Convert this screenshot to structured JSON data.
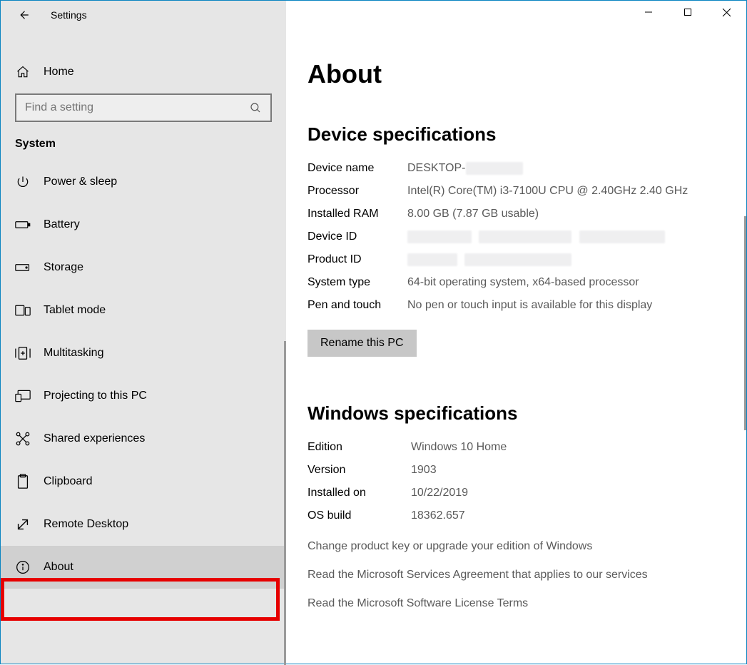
{
  "window": {
    "title": "Settings"
  },
  "sidebar": {
    "home_label": "Home",
    "search_placeholder": "Find a setting",
    "section_label": "System",
    "items": [
      {
        "label": "Power & sleep"
      },
      {
        "label": "Battery"
      },
      {
        "label": "Storage"
      },
      {
        "label": "Tablet mode"
      },
      {
        "label": "Multitasking"
      },
      {
        "label": "Projecting to this PC"
      },
      {
        "label": "Shared experiences"
      },
      {
        "label": "Clipboard"
      },
      {
        "label": "Remote Desktop"
      },
      {
        "label": "About"
      }
    ]
  },
  "main": {
    "title": "About",
    "device_heading": "Device specifications",
    "device": {
      "name_label": "Device name",
      "name_value_prefix": "DESKTOP-",
      "processor_label": "Processor",
      "processor_value": "Intel(R) Core(TM) i3-7100U CPU @ 2.40GHz   2.40 GHz",
      "ram_label": "Installed RAM",
      "ram_value": "8.00 GB (7.87 GB usable)",
      "deviceid_label": "Device ID",
      "productid_label": "Product ID",
      "systype_label": "System type",
      "systype_value": "64-bit operating system, x64-based processor",
      "pen_label": "Pen and touch",
      "pen_value": "No pen or touch input is available for this display",
      "rename_button": "Rename this PC"
    },
    "windows_heading": "Windows specifications",
    "windows": {
      "edition_label": "Edition",
      "edition_value": "Windows 10 Home",
      "version_label": "Version",
      "version_value": "1903",
      "installed_label": "Installed on",
      "installed_value": "10/22/2019",
      "build_label": "OS build",
      "build_value": "18362.657"
    },
    "links": {
      "change_key": "Change product key or upgrade your edition of Windows",
      "services_agreement": "Read the Microsoft Services Agreement that applies to our services",
      "license_terms": "Read the Microsoft Software License Terms"
    }
  }
}
